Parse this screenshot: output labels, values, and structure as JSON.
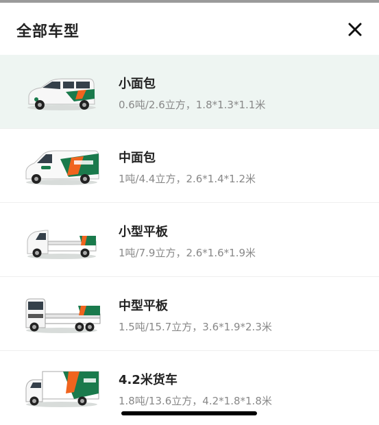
{
  "header": {
    "title": "全部车型"
  },
  "vehicles": [
    {
      "name": "小面包",
      "spec": "0.6吨/2.6立方，1.8*1.3*1.1米",
      "icon": "small-van"
    },
    {
      "name": "中面包",
      "spec": "1吨/4.4立方，2.6*1.4*1.2米",
      "icon": "medium-van"
    },
    {
      "name": "小型平板",
      "spec": "1吨/7.9立方，2.6*1.6*1.9米",
      "icon": "small-flatbed-truck"
    },
    {
      "name": "中型平板",
      "spec": "1.5吨/15.7立方，3.6*1.9*2.3米",
      "icon": "medium-flatbed-truck"
    },
    {
      "name": "4.2米货车",
      "spec": "1.8吨/13.6立方，4.2*1.8*1.8米",
      "icon": "box-truck"
    }
  ],
  "colors": {
    "brand_green": "#1a7a4c",
    "brand_orange": "#f0641e",
    "selected_bg": "#eef5f2"
  }
}
